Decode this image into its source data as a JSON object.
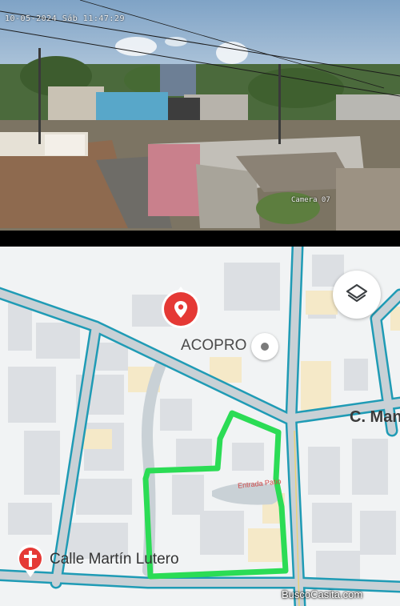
{
  "camera": {
    "timestamp": "10-05-2024 Sáb 11:47:29",
    "name": "Camera 07"
  },
  "map": {
    "labels": {
      "acopro": "ACOPRO",
      "street_east": "C. Mane",
      "street_south": "Calle Martín Lutero",
      "entrance": "Entrada Patio"
    },
    "icons": {
      "place_pin": "location-pin-icon",
      "layers": "layers-icon",
      "poi": "poi-dot-icon",
      "church": "church-pin-icon"
    },
    "colors": {
      "road_outline": "#1f9bb5",
      "road_fill": "#c9d1d6",
      "block": "#dcdfe3",
      "highlight": "#f5e9c8",
      "boundary": "#2bdc55",
      "pin": "#e53935"
    }
  },
  "watermark": "BuscoCasita.com"
}
